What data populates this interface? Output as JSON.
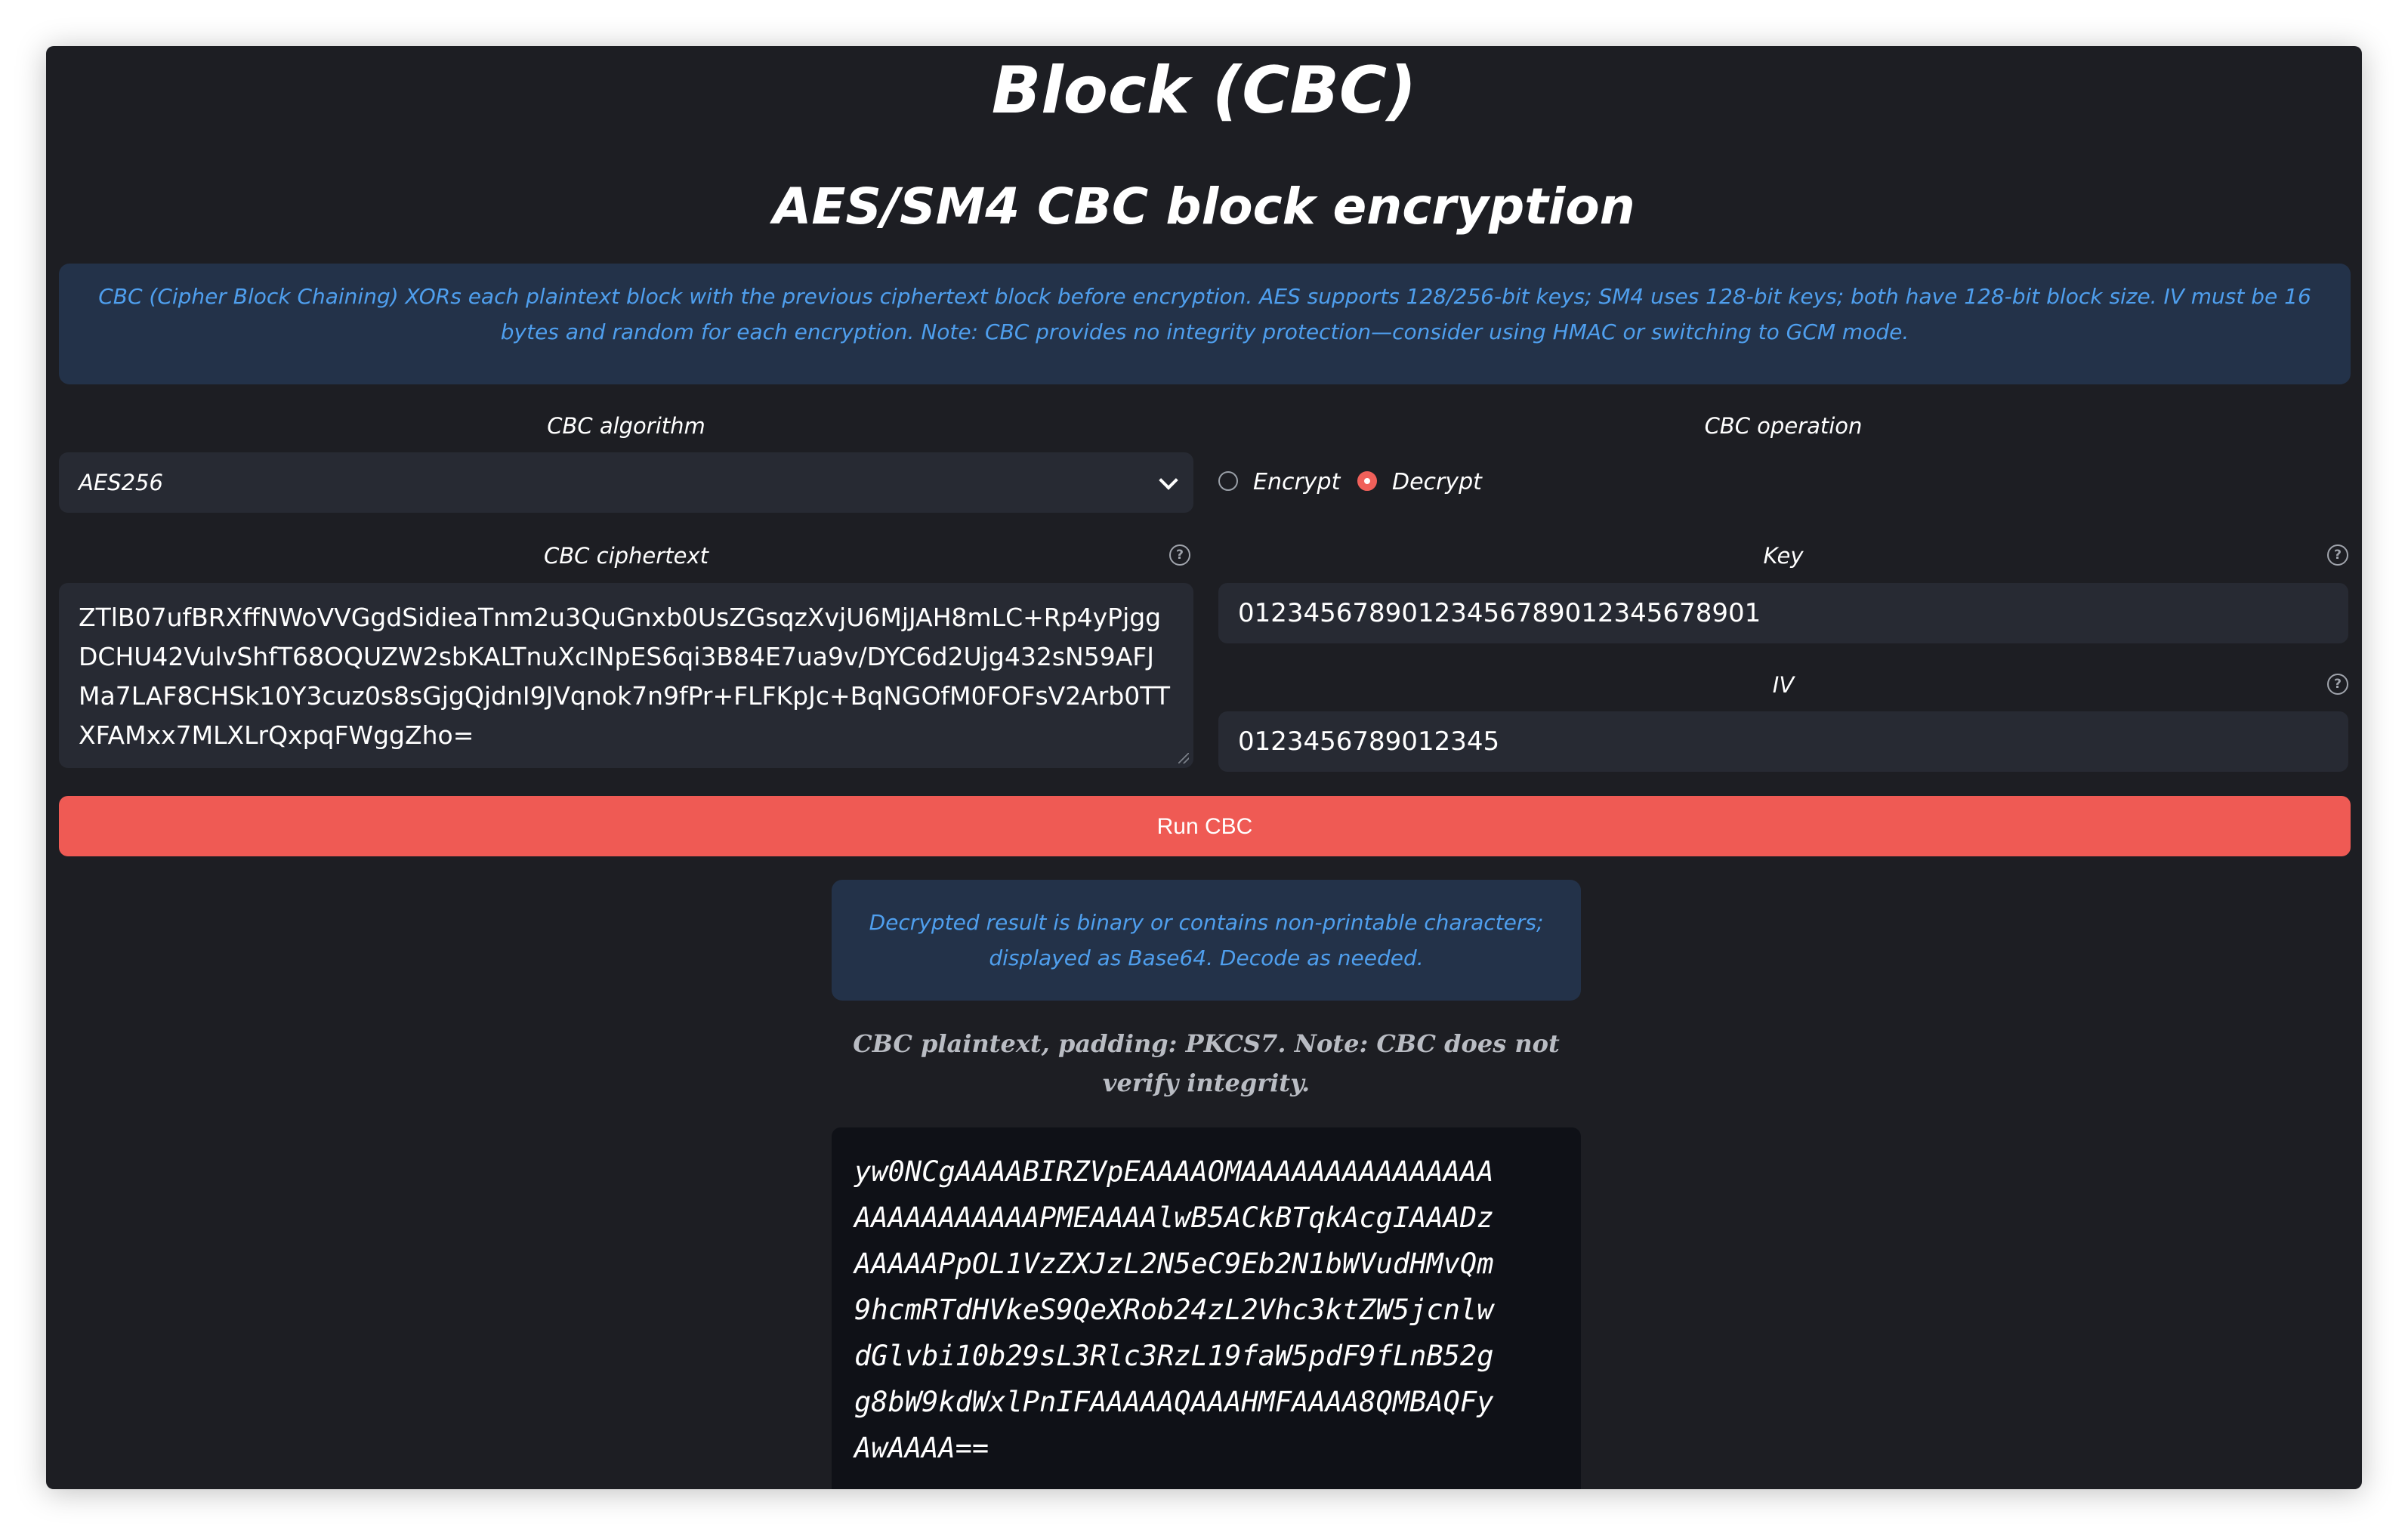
{
  "page": {
    "title": "Block (CBC)",
    "subtitle": "AES/SM4 CBC block encryption",
    "info": "CBC (Cipher Block Chaining) XORs each plaintext block with the previous ciphertext block before encryption. AES supports 128/256-bit keys; SM4 uses 128-bit keys; both have 128-bit block size. IV must be 16 bytes and random for each encryption. Note: CBC provides no integrity protection—consider using HMAC or switching to GCM mode."
  },
  "algorithm": {
    "label": "CBC algorithm",
    "selected": "AES256"
  },
  "operation": {
    "label": "CBC operation",
    "options": [
      {
        "label": "Encrypt",
        "checked": false
      },
      {
        "label": "Decrypt",
        "checked": true
      }
    ]
  },
  "ciphertext": {
    "label": "CBC ciphertext",
    "help": "?",
    "value": "ZTlB07ufBRXffNWoVVGgdSidieaTnm2u3QuGnxb0UsZGsqzXvjU6MjJAH8mLC+Rp4yPjggDCHU42VulvShfT68OQUZW2sbKALTnuXcINpES6qi3B84E7ua9v/DYC6d2Ujg432sN59AFJMa7LAF8CHSk10Y3cuz0s8sGjgQjdnI9JVqnok7n9fPr+FLFKpJc+BqNGOfM0FOFsV2Arb0TTXFAMxx7MLXLrQxpqFWggZho="
  },
  "key": {
    "label": "Key",
    "help": "?",
    "value": "01234567890123456789012345678901"
  },
  "iv": {
    "label": "IV",
    "help": "?",
    "value": "0123456789012345"
  },
  "run_button": {
    "label": "Run CBC"
  },
  "result": {
    "info": "Decrypted result is binary or contains non-printable characters; displayed as Base64. Decode as needed.",
    "caption": "CBC plaintext, padding: PKCS7. Note: CBC does not verify integrity.",
    "output": "yw0NCgAAAABIRZVpEAAAAOMAAAAAAAAAAAAAAA\nAAAAAAAAAAAPMEAAAAlwB5ACkBTqkAcgIAAADz\nAAAAAPpOL1VzZXJzL2N5eC9Eb2N1bWVudHMvQm\n9hcmRTdHVkeS9QeXRob24zL2Vhc3ktZW5jcnlw\ndGlvbi10b29sL3Rlc3RzL19faW5pdF9fLnB52g\ng8bW9kdWxlPnIFAAAAAQAAAHMFAAAA8QMBAQFy\nAwAAAA=="
  },
  "colors": {
    "background": "#1d1e23",
    "accent": "#ef5a54",
    "info_bg": "#233249",
    "info_text": "#4f9fee",
    "field_bg": "#272a33"
  }
}
